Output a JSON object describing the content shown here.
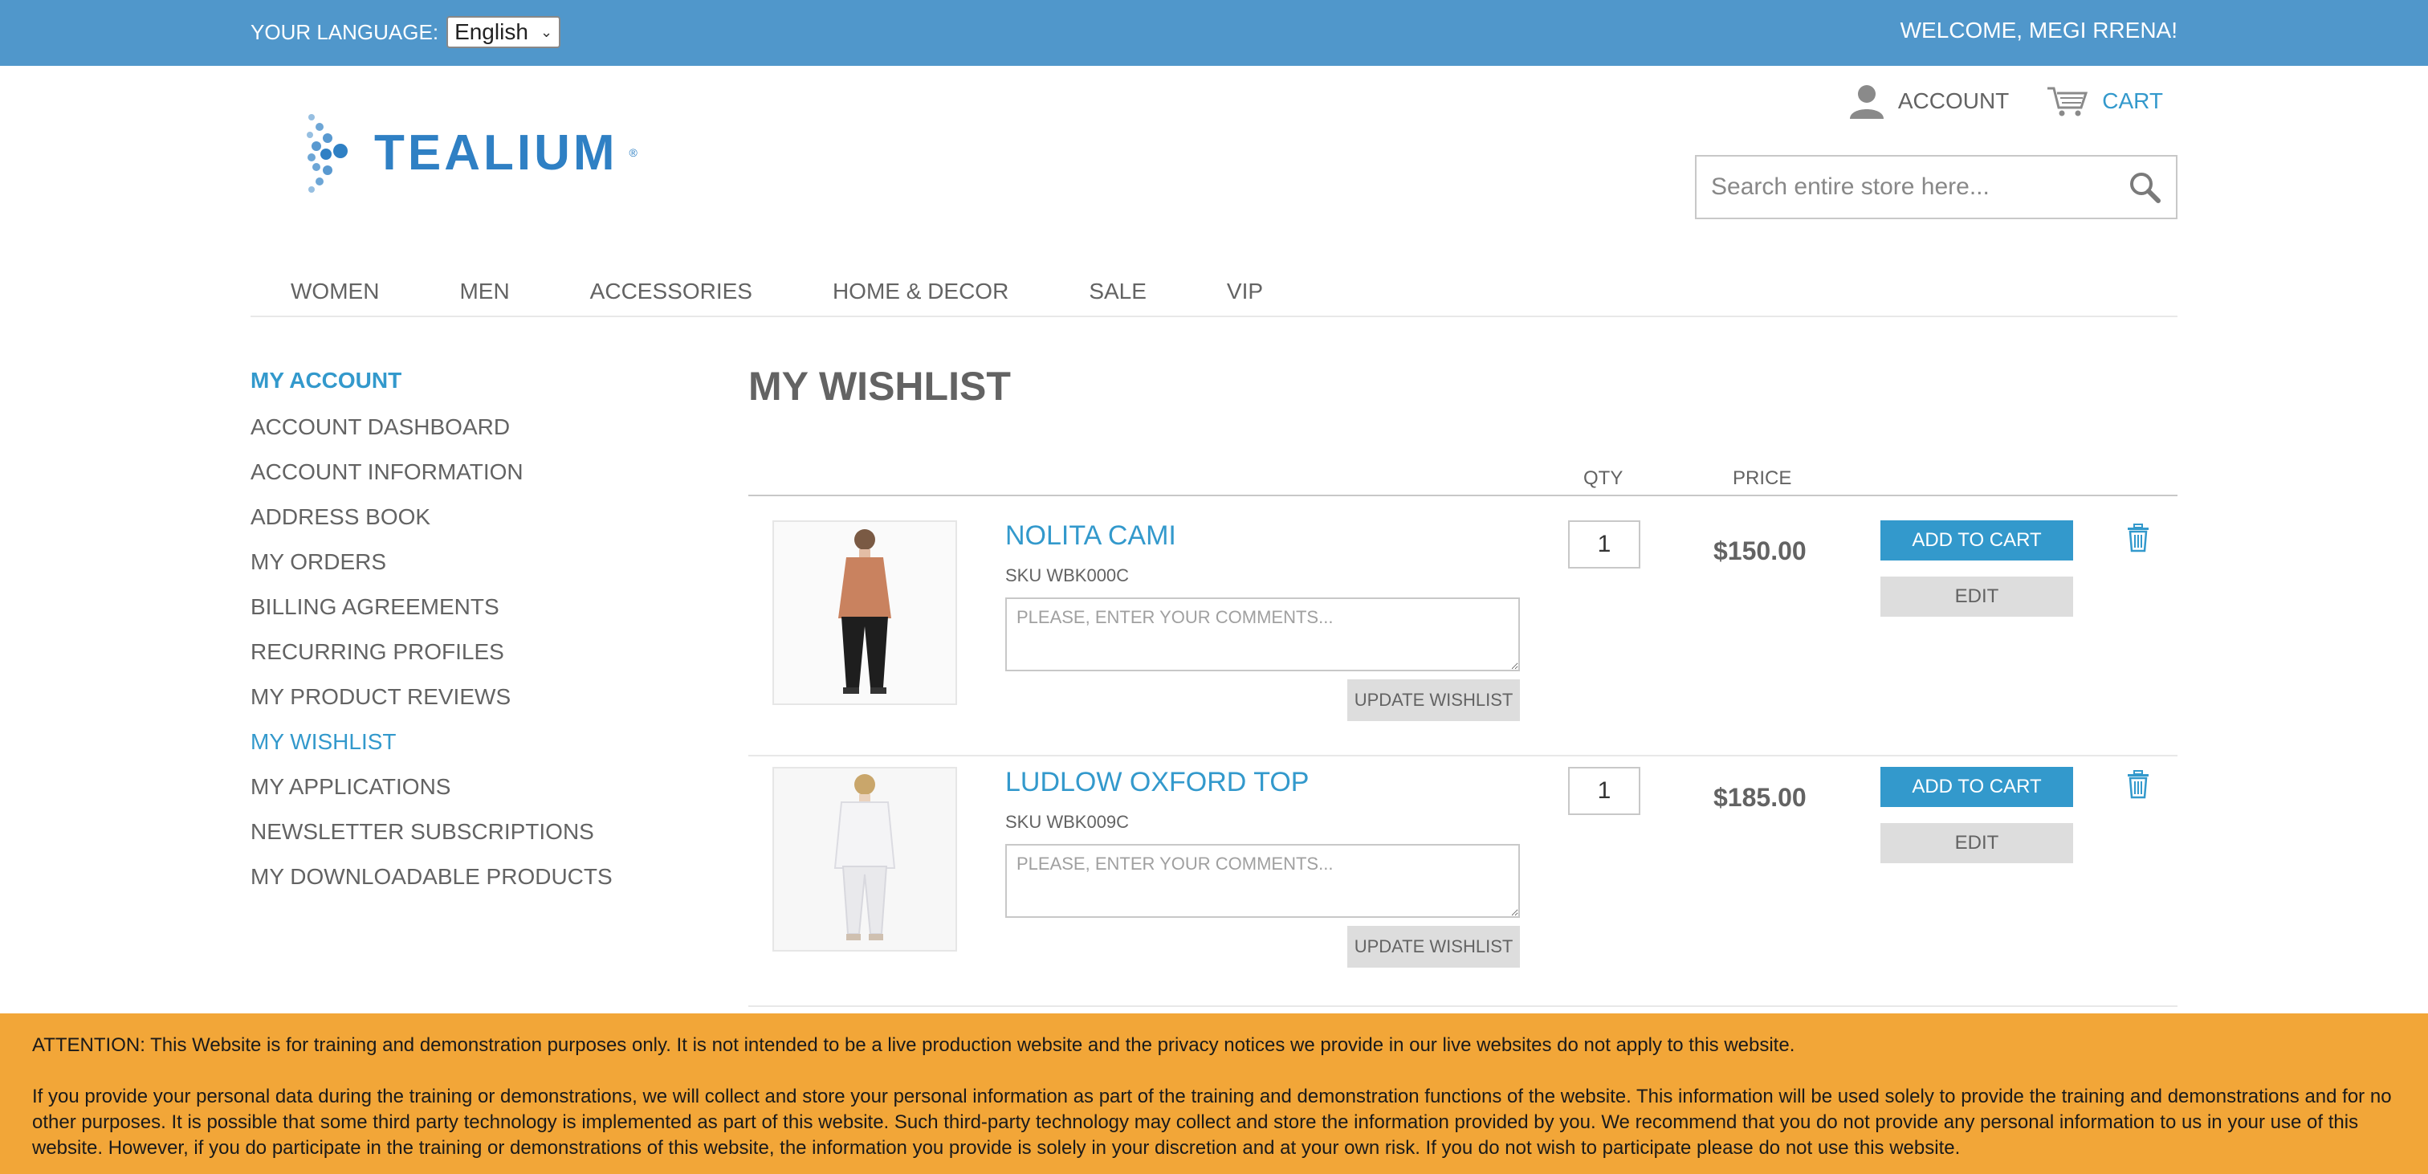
{
  "topbar": {
    "language_label": "YOUR LANGUAGE:",
    "language_value": "English",
    "welcome": "WELCOME, MEGI RRENA!"
  },
  "header": {
    "logo_text": "TEALIUM",
    "account_label": "ACCOUNT",
    "cart_label": "CART",
    "search_placeholder": "Search entire store here..."
  },
  "nav": [
    "WOMEN",
    "MEN",
    "ACCESSORIES",
    "HOME & DECOR",
    "SALE",
    "VIP"
  ],
  "sidebar": {
    "title": "MY ACCOUNT",
    "items": [
      {
        "label": "ACCOUNT DASHBOARD",
        "active": false
      },
      {
        "label": "ACCOUNT INFORMATION",
        "active": false
      },
      {
        "label": "ADDRESS BOOK",
        "active": false
      },
      {
        "label": "MY ORDERS",
        "active": false
      },
      {
        "label": "BILLING AGREEMENTS",
        "active": false
      },
      {
        "label": "RECURRING PROFILES",
        "active": false
      },
      {
        "label": "MY PRODUCT REVIEWS",
        "active": false
      },
      {
        "label": "MY WISHLIST",
        "active": true
      },
      {
        "label": "MY APPLICATIONS",
        "active": false
      },
      {
        "label": "NEWSLETTER SUBSCRIPTIONS",
        "active": false
      },
      {
        "label": "MY DOWNLOADABLE PRODUCTS",
        "active": false
      }
    ]
  },
  "main": {
    "title": "MY WISHLIST",
    "col_qty": "QTY",
    "col_price": "PRICE",
    "comment_placeholder": "PLEASE, ENTER YOUR COMMENTS...",
    "update_label": "UPDATE WISHLIST",
    "add_label": "ADD TO CART",
    "edit_label": "EDIT",
    "items": [
      {
        "name": "NOLITA CAMI",
        "sku": "SKU WBK000C",
        "qty": "1",
        "price": "$150.00",
        "top_color": "#c9825f",
        "bottom_color": "#1e1e1e"
      },
      {
        "name": "LUDLOW OXFORD TOP",
        "sku": "SKU WBK009C",
        "qty": "1",
        "price": "$185.00",
        "top_color": "#f4f4f6",
        "bottom_color": "#e9e9ec"
      }
    ]
  },
  "notice": {
    "line1": "ATTENTION: This Website is for training and demonstration purposes only. It is not intended to be a live production website and the privacy notices we provide in our live websites do not apply to this website.",
    "line2": "If you provide your personal data during the training or demonstrations, we will collect and store your personal information as part of the training and demonstration functions of the website. This information will be used solely to provide the training and demonstrations and for no other purposes. It is possible that some third party technology is implemented as part of this website. Such third-party technology may collect and store the information provided by you. We recommend that you do not provide any personal information to us in your use of this website. However, if you do participate in the training or demonstrations of this website, the information you provide is solely in your discretion and at your own risk. If you do not wish to participate please do not use this website."
  },
  "colors": {
    "topbar": "#5097cb",
    "accent": "#3399cc",
    "notice": "#f2a638"
  }
}
